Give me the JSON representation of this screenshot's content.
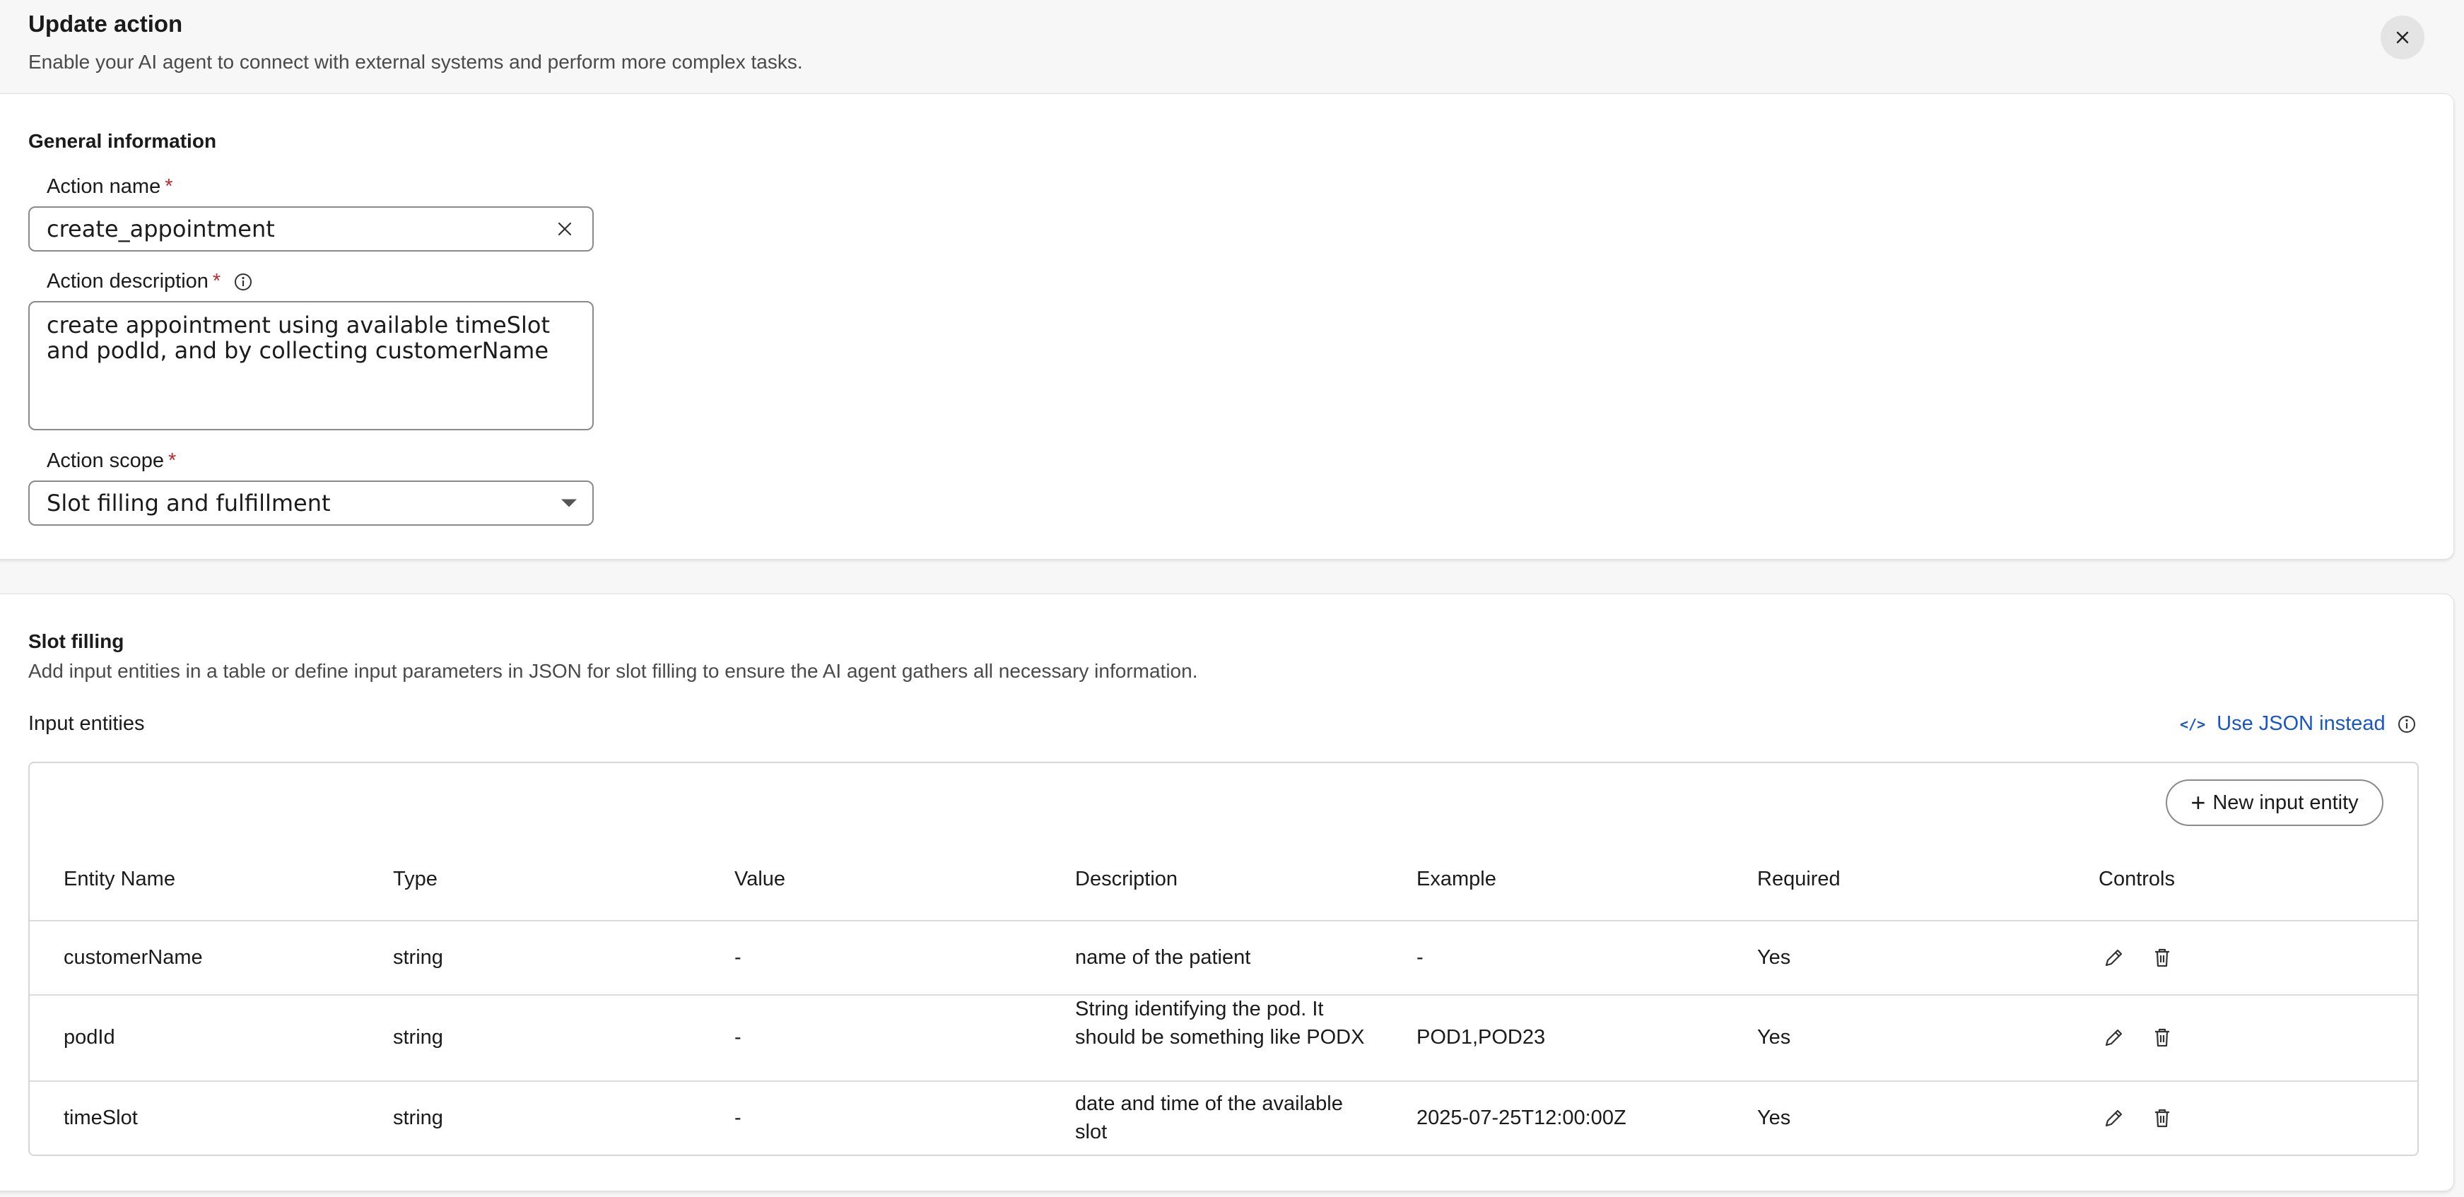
{
  "header": {
    "title": "Update action",
    "subtitle": "Enable your AI agent to connect with external systems and perform more complex tasks."
  },
  "general": {
    "section_title": "General information",
    "action_name": {
      "label": "Action name",
      "required": "*",
      "value": "create_appointment"
    },
    "action_description": {
      "label": "Action description",
      "required": "*",
      "value": "create appointment using available timeSlot and podId, and by collecting customerName"
    },
    "action_scope": {
      "label": "Action scope",
      "required": "*",
      "value": "Slot filling and fulfillment"
    }
  },
  "slot_filling": {
    "section_title": "Slot filling",
    "description": "Add input entities in a table or define input parameters in JSON for slot filling to ensure the AI agent gathers all necessary information.",
    "input_entities_label": "Input entities",
    "json_link": "Use JSON instead",
    "new_button": "New input entity",
    "columns": [
      "Entity Name",
      "Type",
      "Value",
      "Description",
      "Example",
      "Required",
      "Controls"
    ],
    "rows": [
      {
        "name": "customerName",
        "type": "string",
        "value": "-",
        "description": "name of the patient",
        "example": "-",
        "required": "Yes"
      },
      {
        "name": "podId",
        "type": "string",
        "value": "-",
        "description": "String identifying the pod. It should be something like PODX",
        "example": "POD1,POD23",
        "required": "Yes"
      },
      {
        "name": "timeSlot",
        "type": "string",
        "value": "-",
        "description": "date and time of the available slot",
        "example": "2025-07-25T12:00:00Z",
        "required": "Yes"
      }
    ]
  }
}
